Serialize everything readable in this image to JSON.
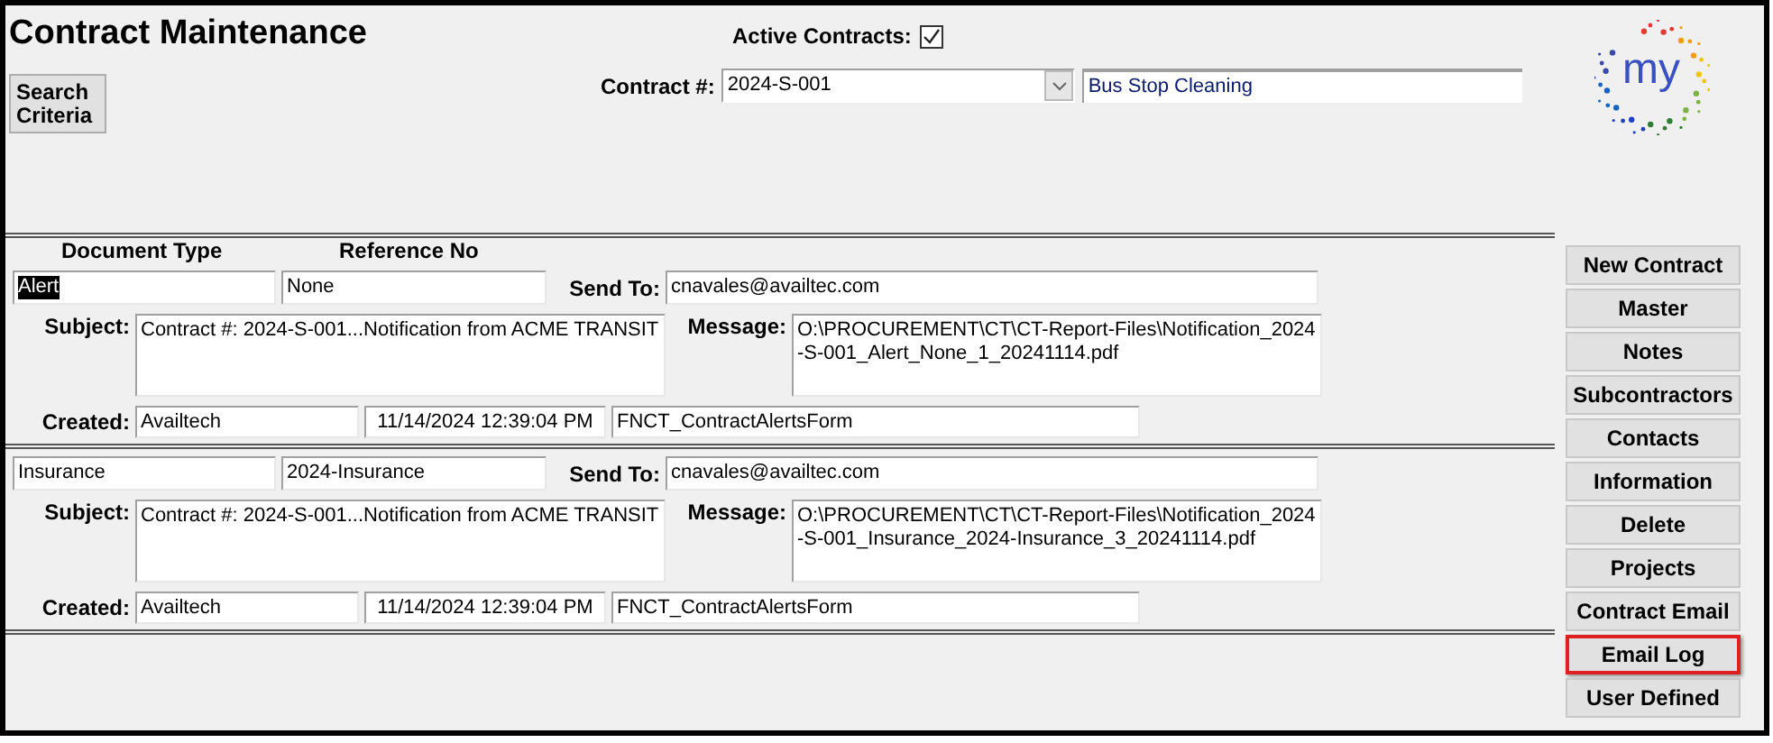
{
  "window": {
    "title": "Contract Maintenance"
  },
  "search_button": {
    "label": "Search\nCriteria"
  },
  "active_contracts": {
    "label": "Active Contracts:",
    "checked": true
  },
  "contract": {
    "label": "Contract #:",
    "value": "2024-S-001",
    "description": "Bus Stop Cleaning"
  },
  "logo": {
    "text": "my"
  },
  "columns": [
    "Document Type",
    "Reference No"
  ],
  "records": [
    {
      "document_type": "Alert",
      "document_type_selected": true,
      "reference_no": "None",
      "send_to_label": "Send To:",
      "send_to": "cnavales@availtec.com",
      "subject_label": "Subject:",
      "subject": "Contract #: 2024-S-001...Notification from ACME TRANSIT",
      "message_label": "Message:",
      "message": "O:\\PROCUREMENT\\CT\\CT-Report-Files\\Notification_2024-S-001_Alert_None_1_20241114.pdf",
      "created_label": "Created:",
      "created_by": "Availtech",
      "created_at": "11/14/2024 12:39:04 PM",
      "form": "FNCT_ContractAlertsForm"
    },
    {
      "document_type": "Insurance",
      "document_type_selected": false,
      "reference_no": "2024-Insurance",
      "send_to_label": "Send To:",
      "send_to": "cnavales@availtec.com",
      "subject_label": "Subject:",
      "subject": "Contract #: 2024-S-001...Notification from ACME TRANSIT",
      "message_label": "Message:",
      "message": "O:\\PROCUREMENT\\CT\\CT-Report-Files\\Notification_2024-S-001_Insurance_2024-Insurance_3_20241114.pdf",
      "created_label": "Created:",
      "created_by": "Availtech",
      "created_at": "11/14/2024 12:39:04 PM",
      "form": "FNCT_ContractAlertsForm"
    }
  ],
  "side_buttons": [
    {
      "label": "New Contract",
      "highlighted": false
    },
    {
      "label": "Master",
      "highlighted": false
    },
    {
      "label": "Notes",
      "highlighted": false
    },
    {
      "label": "Subcontractors",
      "highlighted": false
    },
    {
      "label": "Contacts",
      "highlighted": false
    },
    {
      "label": "Information",
      "highlighted": false
    },
    {
      "label": "Delete",
      "highlighted": false
    },
    {
      "label": "Projects",
      "highlighted": false
    },
    {
      "label": "Contract Email",
      "highlighted": false
    },
    {
      "label": "Email Log",
      "highlighted": true
    },
    {
      "label": "User Defined",
      "highlighted": false
    }
  ]
}
